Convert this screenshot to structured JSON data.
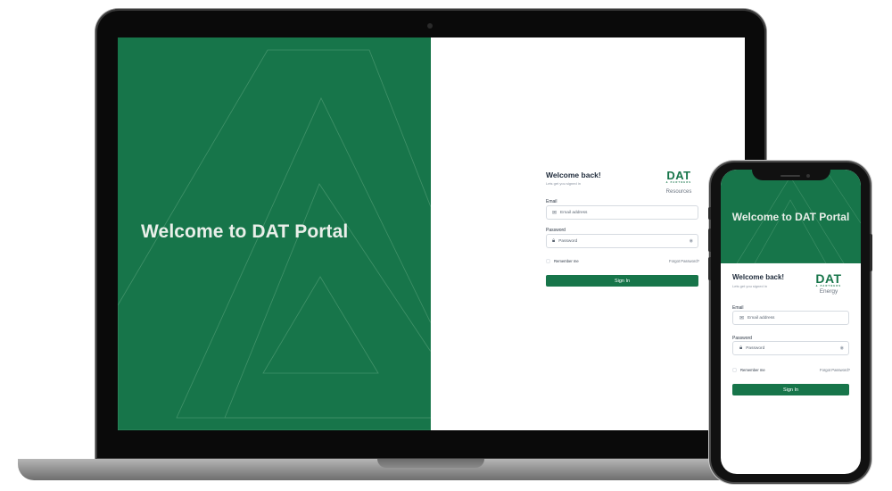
{
  "desktop": {
    "hero_title": "Welcome to DAT Portal",
    "login": {
      "title": "Welcome back!",
      "subtitle": "Lets get you signed in",
      "brand": {
        "logo": "DAT",
        "logo_small": "& PARTNERS",
        "name": "Resources"
      },
      "email_label": "Email",
      "email_placeholder": "Email address",
      "password_label": "Password",
      "password_placeholder": "Password",
      "remember_label": "Remember me",
      "forgot_label": "Forgot Password?",
      "signin_label": "Sign In"
    }
  },
  "mobile": {
    "hero_title": "Welcome to DAT Portal",
    "login": {
      "title": "Welcome back!",
      "subtitle": "Lets get you signed in",
      "brand": {
        "logo": "DAT",
        "logo_small": "& PARTNERS",
        "name": "Energy"
      },
      "email_label": "Email",
      "email_placeholder": "Email address",
      "password_label": "Password",
      "password_placeholder": "Password",
      "remember_label": "Remember me",
      "forgot_label": "Forgot Password?",
      "signin_label": "Sign In"
    }
  },
  "icons": {
    "email": "mail-icon",
    "password": "lock-icon",
    "toggle": "eye-icon"
  },
  "colors": {
    "brand_green": "#17754a",
    "hero_text": "#e9efe9",
    "device_frame": "#0a0a0a"
  }
}
